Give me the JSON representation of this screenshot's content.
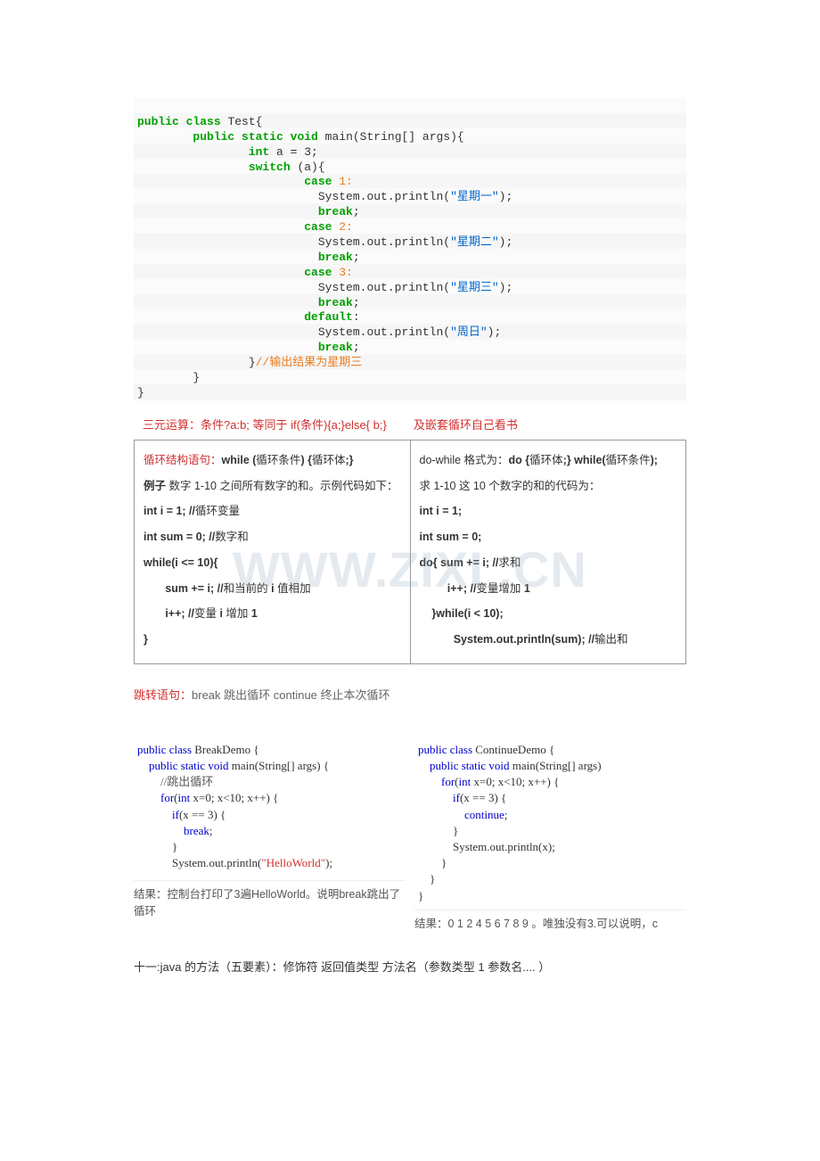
{
  "code1": {
    "l1a": "public",
    "l1b": "class",
    "l1c": " Test{",
    "l2a": "public",
    "l2b": "static void",
    "l2c": " main(String[] args){",
    "l3a": "int",
    "l3b": " a = 3;",
    "l4a": "switch",
    "l4b": " (a){",
    "l5a": "case",
    "l5b": " 1:",
    "l6": "  System.out.println(",
    "l6s": "\"星期一\"",
    "l6e": ");",
    "l7": "break",
    "l7e": ";",
    "l8a": "case",
    "l8b": " 2:",
    "l9": "  System.out.println(",
    "l9s": "\"星期二\"",
    "l9e": ");",
    "l10": "break",
    "l10e": ";",
    "l11a": "case",
    "l11b": " 3:",
    "l12": "  System.out.println(",
    "l12s": "\"星期三\"",
    "l12e": ");",
    "l13": "break",
    "l13e": ";",
    "l14": "default",
    "l14e": ":",
    "l15": "  System.out.println(",
    "l15s": "\"周日\"",
    "l15e": ");",
    "l16": "break",
    "l16e": ";",
    "l17a": "}",
    "l17b": "//输出结果为星期三",
    "l18": "        }",
    "l19": "}"
  },
  "ternary_left": "三元运算：条件?a:b;  等同于 if(条件){a;}else{ b;}",
  "ternary_right": "及嵌套循环自己看书",
  "tableLeft": {
    "l1a": "循环结构语句：",
    "l1b": "while (",
    "l1c": "循环条件",
    "l1d": ") {",
    "l1e": "循环体",
    "l1f": ";}",
    "l2a": "例子",
    "l2b": " 数字 1-10  之间所有数字的和。示例代码如下：",
    "l3": "int i = 1; //",
    "l3c": "循环变量",
    "l4": "int sum = 0; //",
    "l4c": "数字和",
    "l5": "while(i <= 10){",
    "l6a": "sum += i; //",
    "l6b": "和当前的",
    "l6c": " i ",
    "l6d": "值相加",
    "l7a": "i++; //",
    "l7b": "变量",
    "l7c": " i ",
    "l7d": "增加",
    "l7e": " 1",
    "l8": "}"
  },
  "tableRight": {
    "l1a": "do-while ",
    "l1b": "格式为：",
    "l1c": "do {",
    "l1d": "循环体",
    "l1e": ";}    while(",
    "l1f": "循环条件",
    "l1g": ");",
    "l2": "求 1-10  这 10  个数字的和的代码为：",
    "l3": "int i = 1;",
    "l4": "int sum = 0;",
    "l5a": "do{    sum += i; //",
    "l5b": "求和",
    "l6a": "i++; //",
    "l6b": "变量增加",
    "l6c": " 1",
    "l7": "}while(i < 10);",
    "l8a": "System.out.println(sum); //",
    "l8b": "输出和"
  },
  "watermark": "WWW.ZIXI          .CN",
  "jump": {
    "a": "跳转语句：",
    "b": "break 跳出循环  continue  终止本次循环"
  },
  "demoBreak": {
    "l1": "public class BreakDemo {",
    "l2": "    public static void main(String[] args) {",
    "l3": "        //跳出循环",
    "l4": "        for(int x=0; x<10; x++) {",
    "l5": "            if(x == 3) {",
    "l6": "                break;",
    "l7": "            }",
    "l8": "            System.out.println(\"HelloWorld\");",
    "l9": "",
    "res": "结果：控制台打印了3遍HelloWorld。说明break跳出了循环"
  },
  "demoContinue": {
    "l1": "public class ContinueDemo {",
    "l2": "    public static void main(String[] args)",
    "l3": "        for(int x=0; x<10; x++) {",
    "l4": "            if(x == 3) {",
    "l5": "                continue;",
    "l6": "            }",
    "l7": "            System.out.println(x);",
    "l8": "        }",
    "l9": "    }",
    "l10": "}",
    "res": "结果：0 1 2 4 5 6 7 8 9 。唯独没有3.可以说明，c"
  },
  "final": "十一:java 的方法（五要素）：修饰符    返回值类型  方法名（参数类型 1  参数名.... ）"
}
